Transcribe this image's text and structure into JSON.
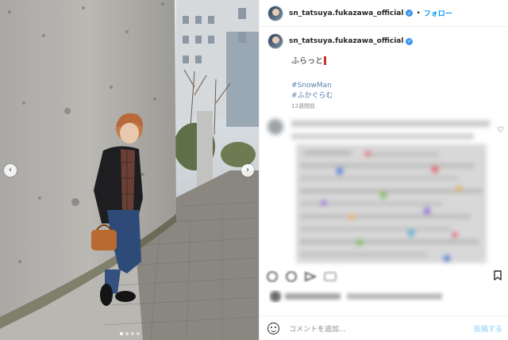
{
  "photo": {
    "prev_icon": "‹",
    "next_icon": "›",
    "carousel_pages": 4,
    "carousel_active": 1
  },
  "header": {
    "username": "sn_tatsuya.fukazawa_official",
    "verified_icon": "✓",
    "separator": "•",
    "follow_label": "フォロー"
  },
  "caption": {
    "username": "sn_tatsuya.fukazawa_official",
    "verified_icon": "✓",
    "text": "ふらっと",
    "hashtags": [
      "#SnowMan",
      "#ふかぐらむ"
    ],
    "time": "12週間前"
  },
  "actions": {
    "icons": [
      "heart-icon",
      "comment-icon",
      "share-icon",
      "bookmark-icon"
    ]
  },
  "comment_box": {
    "placeholder": "コメントを追加...",
    "post_label": "投稿する"
  },
  "colors": {
    "link": "#0095f6",
    "hashtag": "#00376b",
    "muted": "#8e8e8e",
    "verified": "#3897f0"
  }
}
